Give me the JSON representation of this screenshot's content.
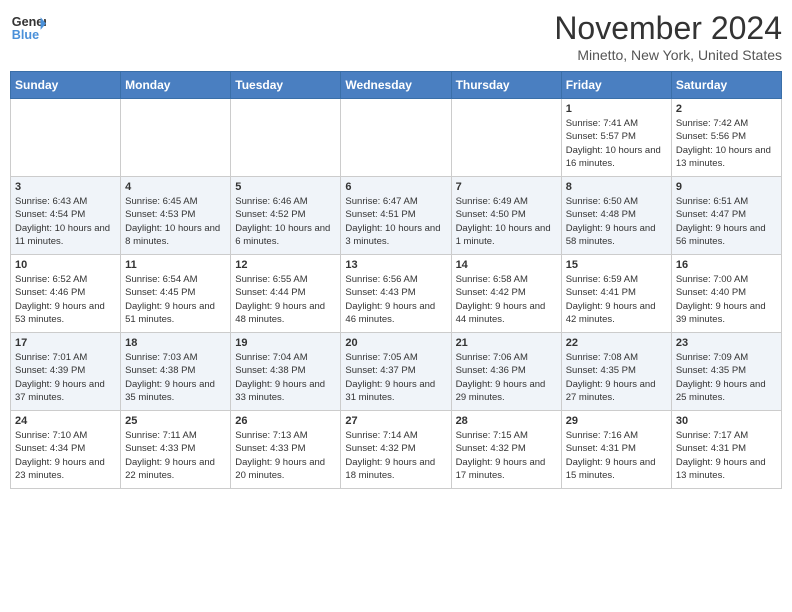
{
  "header": {
    "logo_line1": "General",
    "logo_line2": "Blue",
    "month": "November 2024",
    "location": "Minetto, New York, United States"
  },
  "weekdays": [
    "Sunday",
    "Monday",
    "Tuesday",
    "Wednesday",
    "Thursday",
    "Friday",
    "Saturday"
  ],
  "weeks": [
    [
      {
        "day": "",
        "info": ""
      },
      {
        "day": "",
        "info": ""
      },
      {
        "day": "",
        "info": ""
      },
      {
        "day": "",
        "info": ""
      },
      {
        "day": "",
        "info": ""
      },
      {
        "day": "1",
        "info": "Sunrise: 7:41 AM\nSunset: 5:57 PM\nDaylight: 10 hours and 16 minutes."
      },
      {
        "day": "2",
        "info": "Sunrise: 7:42 AM\nSunset: 5:56 PM\nDaylight: 10 hours and 13 minutes."
      }
    ],
    [
      {
        "day": "3",
        "info": "Sunrise: 6:43 AM\nSunset: 4:54 PM\nDaylight: 10 hours and 11 minutes."
      },
      {
        "day": "4",
        "info": "Sunrise: 6:45 AM\nSunset: 4:53 PM\nDaylight: 10 hours and 8 minutes."
      },
      {
        "day": "5",
        "info": "Sunrise: 6:46 AM\nSunset: 4:52 PM\nDaylight: 10 hours and 6 minutes."
      },
      {
        "day": "6",
        "info": "Sunrise: 6:47 AM\nSunset: 4:51 PM\nDaylight: 10 hours and 3 minutes."
      },
      {
        "day": "7",
        "info": "Sunrise: 6:49 AM\nSunset: 4:50 PM\nDaylight: 10 hours and 1 minute."
      },
      {
        "day": "8",
        "info": "Sunrise: 6:50 AM\nSunset: 4:48 PM\nDaylight: 9 hours and 58 minutes."
      },
      {
        "day": "9",
        "info": "Sunrise: 6:51 AM\nSunset: 4:47 PM\nDaylight: 9 hours and 56 minutes."
      }
    ],
    [
      {
        "day": "10",
        "info": "Sunrise: 6:52 AM\nSunset: 4:46 PM\nDaylight: 9 hours and 53 minutes."
      },
      {
        "day": "11",
        "info": "Sunrise: 6:54 AM\nSunset: 4:45 PM\nDaylight: 9 hours and 51 minutes."
      },
      {
        "day": "12",
        "info": "Sunrise: 6:55 AM\nSunset: 4:44 PM\nDaylight: 9 hours and 48 minutes."
      },
      {
        "day": "13",
        "info": "Sunrise: 6:56 AM\nSunset: 4:43 PM\nDaylight: 9 hours and 46 minutes."
      },
      {
        "day": "14",
        "info": "Sunrise: 6:58 AM\nSunset: 4:42 PM\nDaylight: 9 hours and 44 minutes."
      },
      {
        "day": "15",
        "info": "Sunrise: 6:59 AM\nSunset: 4:41 PM\nDaylight: 9 hours and 42 minutes."
      },
      {
        "day": "16",
        "info": "Sunrise: 7:00 AM\nSunset: 4:40 PM\nDaylight: 9 hours and 39 minutes."
      }
    ],
    [
      {
        "day": "17",
        "info": "Sunrise: 7:01 AM\nSunset: 4:39 PM\nDaylight: 9 hours and 37 minutes."
      },
      {
        "day": "18",
        "info": "Sunrise: 7:03 AM\nSunset: 4:38 PM\nDaylight: 9 hours and 35 minutes."
      },
      {
        "day": "19",
        "info": "Sunrise: 7:04 AM\nSunset: 4:38 PM\nDaylight: 9 hours and 33 minutes."
      },
      {
        "day": "20",
        "info": "Sunrise: 7:05 AM\nSunset: 4:37 PM\nDaylight: 9 hours and 31 minutes."
      },
      {
        "day": "21",
        "info": "Sunrise: 7:06 AM\nSunset: 4:36 PM\nDaylight: 9 hours and 29 minutes."
      },
      {
        "day": "22",
        "info": "Sunrise: 7:08 AM\nSunset: 4:35 PM\nDaylight: 9 hours and 27 minutes."
      },
      {
        "day": "23",
        "info": "Sunrise: 7:09 AM\nSunset: 4:35 PM\nDaylight: 9 hours and 25 minutes."
      }
    ],
    [
      {
        "day": "24",
        "info": "Sunrise: 7:10 AM\nSunset: 4:34 PM\nDaylight: 9 hours and 23 minutes."
      },
      {
        "day": "25",
        "info": "Sunrise: 7:11 AM\nSunset: 4:33 PM\nDaylight: 9 hours and 22 minutes."
      },
      {
        "day": "26",
        "info": "Sunrise: 7:13 AM\nSunset: 4:33 PM\nDaylight: 9 hours and 20 minutes."
      },
      {
        "day": "27",
        "info": "Sunrise: 7:14 AM\nSunset: 4:32 PM\nDaylight: 9 hours and 18 minutes."
      },
      {
        "day": "28",
        "info": "Sunrise: 7:15 AM\nSunset: 4:32 PM\nDaylight: 9 hours and 17 minutes."
      },
      {
        "day": "29",
        "info": "Sunrise: 7:16 AM\nSunset: 4:31 PM\nDaylight: 9 hours and 15 minutes."
      },
      {
        "day": "30",
        "info": "Sunrise: 7:17 AM\nSunset: 4:31 PM\nDaylight: 9 hours and 13 minutes."
      }
    ]
  ]
}
